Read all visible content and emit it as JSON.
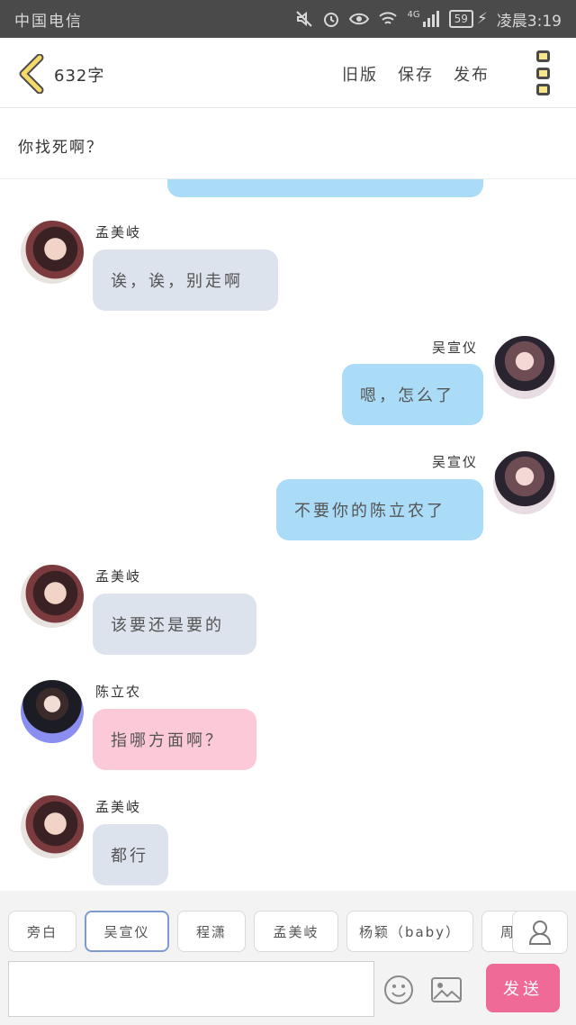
{
  "status_bar": {
    "carrier": "中国电信",
    "signal_label": "4G",
    "battery": "59",
    "time": "凌晨3:19"
  },
  "header": {
    "title": "632字",
    "actions": [
      "旧版",
      "保存",
      "发布"
    ]
  },
  "topic": "你找死啊？",
  "messages": [
    {
      "side": "left",
      "speaker": "孟美岐",
      "text": "诶，诶，别走啊",
      "bubble": "gray",
      "avatar": "孟美岐"
    },
    {
      "side": "right",
      "speaker": "吴宣仪",
      "text": "嗯，怎么了",
      "bubble": "blue",
      "avatar": "吴宣仪"
    },
    {
      "side": "right",
      "speaker": "吴宣仪",
      "text": "不要你的陈立农了",
      "bubble": "blue",
      "avatar": "吴宣仪"
    },
    {
      "side": "left",
      "speaker": "孟美岐",
      "text": "该要还是要的",
      "bubble": "gray",
      "avatar": "孟美岐"
    },
    {
      "side": "left",
      "speaker": "陈立农",
      "text": "指哪方面啊？",
      "bubble": "pink",
      "avatar": "陈立农"
    },
    {
      "side": "left",
      "speaker": "孟美岐",
      "text": "都行",
      "bubble": "gray",
      "avatar": "孟美岐"
    }
  ],
  "speaker_chips": [
    {
      "label": "旁白",
      "active": false
    },
    {
      "label": "吴宣仪",
      "active": true
    },
    {
      "label": "程潇",
      "active": false
    },
    {
      "label": "孟美岐",
      "active": false
    },
    {
      "label": "杨颖（baby）",
      "active": false
    },
    {
      "label": "周",
      "active": false
    }
  ],
  "composer": {
    "placeholder": "",
    "send_label": "发送"
  },
  "colors": {
    "bubble_gray": "#dde3ec",
    "bubble_blue": "#aadcf7",
    "bubble_pink": "#fbc9d8",
    "send_button": "#f06a98",
    "back_chevron": "#f6d96b"
  },
  "icons": [
    "back-chevron-icon",
    "more-menu-icon",
    "user-icon",
    "emoji-icon",
    "image-icon",
    "mute-icon",
    "alarm-icon",
    "eye-icon",
    "wifi-icon",
    "signal-icon",
    "battery-icon",
    "charging-icon"
  ]
}
